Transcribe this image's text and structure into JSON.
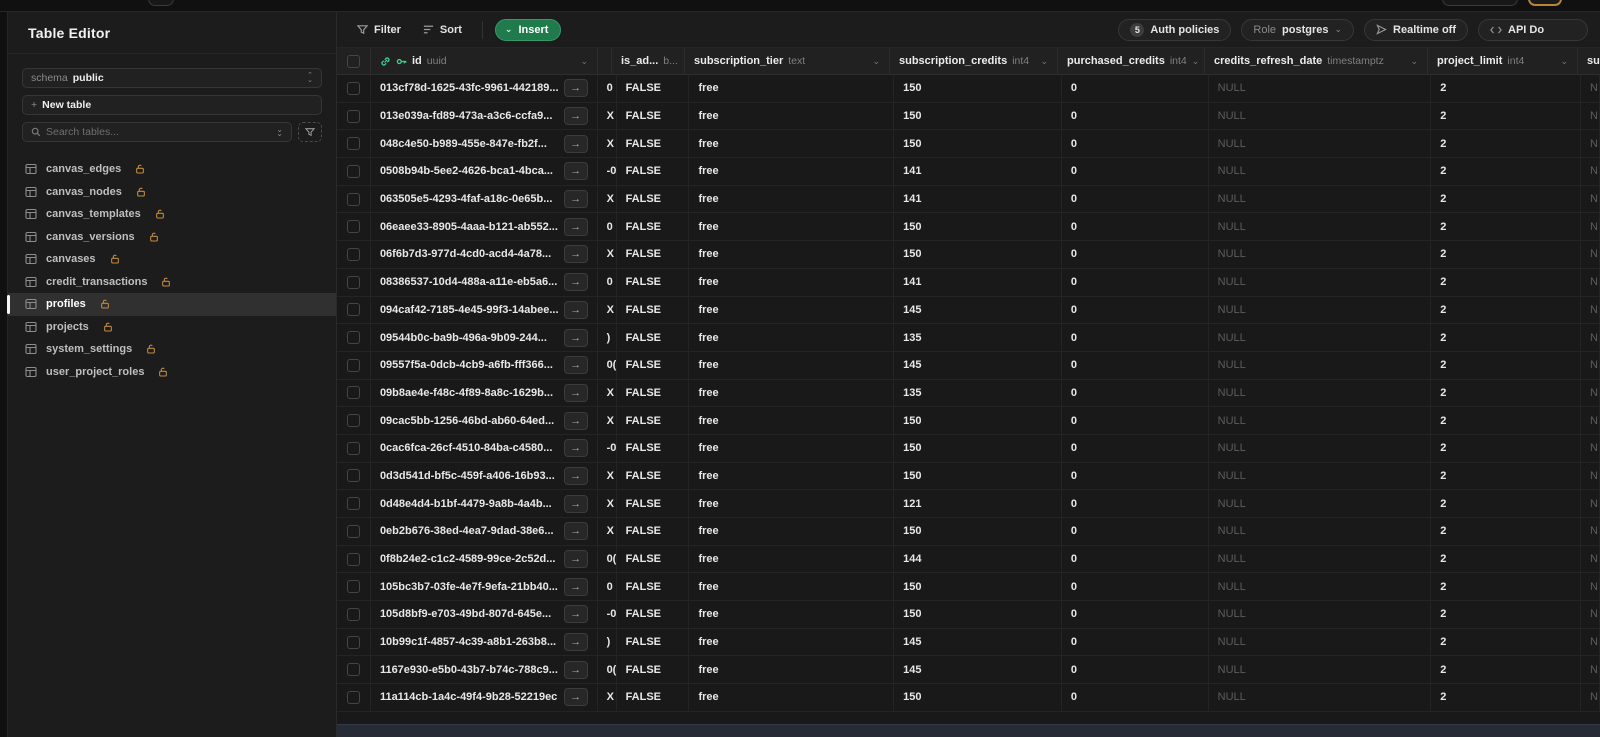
{
  "sidebar": {
    "title": "Table Editor",
    "schema_label": "schema",
    "schema_value": "public",
    "new_table_label": "New table",
    "search_placeholder": "Search tables...",
    "tables": [
      {
        "name": "canvas_edges",
        "selected": false,
        "locked": false
      },
      {
        "name": "canvas_nodes",
        "selected": false,
        "locked": false
      },
      {
        "name": "canvas_templates",
        "selected": false,
        "locked": false
      },
      {
        "name": "canvas_versions",
        "selected": false,
        "locked": false
      },
      {
        "name": "canvases",
        "selected": false,
        "locked": false
      },
      {
        "name": "credit_transactions",
        "selected": false,
        "locked": false
      },
      {
        "name": "profiles",
        "selected": true,
        "locked": false
      },
      {
        "name": "projects",
        "selected": false,
        "locked": false
      },
      {
        "name": "system_settings",
        "selected": false,
        "locked": true
      },
      {
        "name": "user_project_roles",
        "selected": false,
        "locked": false
      }
    ]
  },
  "toolbar": {
    "filter_label": "Filter",
    "sort_label": "Sort",
    "insert_label": "Insert",
    "auth_policies_count": "5",
    "auth_policies_label": "Auth policies",
    "role_label": "Role",
    "role_value": "postgres",
    "realtime_label": "Realtime off",
    "api_docs_label": "API Do"
  },
  "grid": {
    "columns": [
      {
        "name": "id",
        "type": "uuid"
      },
      {
        "name": "is_ad...",
        "type": "b..."
      },
      {
        "name": "subscription_tier",
        "type": "text"
      },
      {
        "name": "subscription_credits",
        "type": "int4"
      },
      {
        "name": "purchased_credits",
        "type": "int4"
      },
      {
        "name": "credits_refresh_date",
        "type": "timestamptz"
      },
      {
        "name": "project_limit",
        "type": "int4"
      },
      {
        "name": "su",
        "type": ""
      }
    ],
    "rows": [
      {
        "id": "013cf78d-1625-43fc-9961-442189...",
        "clip": "0",
        "is_admin": "FALSE",
        "subscription_tier": "free",
        "subscription_credits": "150",
        "purchased_credits": "0",
        "credits_refresh_date": "NULL",
        "project_limit": "2",
        "last": "N"
      },
      {
        "id": "013e039a-fd89-473a-a3c6-ccfa9...",
        "clip": "X",
        "is_admin": "FALSE",
        "subscription_tier": "free",
        "subscription_credits": "150",
        "purchased_credits": "0",
        "credits_refresh_date": "NULL",
        "project_limit": "2",
        "last": "N"
      },
      {
        "id": "048c4e50-b989-455e-847e-fb2f...",
        "clip": "X",
        "is_admin": "FALSE",
        "subscription_tier": "free",
        "subscription_credits": "150",
        "purchased_credits": "0",
        "credits_refresh_date": "NULL",
        "project_limit": "2",
        "last": "N"
      },
      {
        "id": "0508b94b-5ee2-4626-bca1-4bca...",
        "clip": "-0",
        "is_admin": "FALSE",
        "subscription_tier": "free",
        "subscription_credits": "141",
        "purchased_credits": "0",
        "credits_refresh_date": "NULL",
        "project_limit": "2",
        "last": "N"
      },
      {
        "id": "063505e5-4293-4faf-a18c-0e65b...",
        "clip": "X",
        "is_admin": "FALSE",
        "subscription_tier": "free",
        "subscription_credits": "141",
        "purchased_credits": "0",
        "credits_refresh_date": "NULL",
        "project_limit": "2",
        "last": "N"
      },
      {
        "id": "06eaee33-8905-4aaa-b121-ab552...",
        "clip": "0",
        "is_admin": "FALSE",
        "subscription_tier": "free",
        "subscription_credits": "150",
        "purchased_credits": "0",
        "credits_refresh_date": "NULL",
        "project_limit": "2",
        "last": "N"
      },
      {
        "id": "06f6b7d3-977d-4cd0-acd4-4a78...",
        "clip": "X",
        "is_admin": "FALSE",
        "subscription_tier": "free",
        "subscription_credits": "150",
        "purchased_credits": "0",
        "credits_refresh_date": "NULL",
        "project_limit": "2",
        "last": "N"
      },
      {
        "id": "08386537-10d4-488a-a11e-eb5a6...",
        "clip": "0",
        "is_admin": "FALSE",
        "subscription_tier": "free",
        "subscription_credits": "141",
        "purchased_credits": "0",
        "credits_refresh_date": "NULL",
        "project_limit": "2",
        "last": "N"
      },
      {
        "id": "094caf42-7185-4e45-99f3-14abee...",
        "clip": "X",
        "is_admin": "FALSE",
        "subscription_tier": "free",
        "subscription_credits": "145",
        "purchased_credits": "0",
        "credits_refresh_date": "NULL",
        "project_limit": "2",
        "last": "N"
      },
      {
        "id": "09544b0c-ba9b-496a-9b09-244...",
        "clip": ")",
        "is_admin": "FALSE",
        "subscription_tier": "free",
        "subscription_credits": "135",
        "purchased_credits": "0",
        "credits_refresh_date": "NULL",
        "project_limit": "2",
        "last": "N"
      },
      {
        "id": "09557f5a-0dcb-4cb9-a6fb-fff366...",
        "clip": "0(",
        "is_admin": "FALSE",
        "subscription_tier": "free",
        "subscription_credits": "145",
        "purchased_credits": "0",
        "credits_refresh_date": "NULL",
        "project_limit": "2",
        "last": "N"
      },
      {
        "id": "09b8ae4e-f48c-4f89-8a8c-1629b...",
        "clip": "X",
        "is_admin": "FALSE",
        "subscription_tier": "free",
        "subscription_credits": "135",
        "purchased_credits": "0",
        "credits_refresh_date": "NULL",
        "project_limit": "2",
        "last": "N"
      },
      {
        "id": "09cac5bb-1256-46bd-ab60-64ed...",
        "clip": "X",
        "is_admin": "FALSE",
        "subscription_tier": "free",
        "subscription_credits": "150",
        "purchased_credits": "0",
        "credits_refresh_date": "NULL",
        "project_limit": "2",
        "last": "N"
      },
      {
        "id": "0cac6fca-26cf-4510-84ba-c4580...",
        "clip": "-0",
        "is_admin": "FALSE",
        "subscription_tier": "free",
        "subscription_credits": "150",
        "purchased_credits": "0",
        "credits_refresh_date": "NULL",
        "project_limit": "2",
        "last": "N"
      },
      {
        "id": "0d3d541d-bf5c-459f-a406-16b93...",
        "clip": "X",
        "is_admin": "FALSE",
        "subscription_tier": "free",
        "subscription_credits": "150",
        "purchased_credits": "0",
        "credits_refresh_date": "NULL",
        "project_limit": "2",
        "last": "N"
      },
      {
        "id": "0d48e4d4-b1bf-4479-9a8b-4a4b...",
        "clip": "X",
        "is_admin": "FALSE",
        "subscription_tier": "free",
        "subscription_credits": "121",
        "purchased_credits": "0",
        "credits_refresh_date": "NULL",
        "project_limit": "2",
        "last": "N"
      },
      {
        "id": "0eb2b676-38ed-4ea7-9dad-38e6...",
        "clip": "X",
        "is_admin": "FALSE",
        "subscription_tier": "free",
        "subscription_credits": "150",
        "purchased_credits": "0",
        "credits_refresh_date": "NULL",
        "project_limit": "2",
        "last": "N"
      },
      {
        "id": "0f8b24e2-c1c2-4589-99ce-2c52d...",
        "clip": "0(",
        "is_admin": "FALSE",
        "subscription_tier": "free",
        "subscription_credits": "144",
        "purchased_credits": "0",
        "credits_refresh_date": "NULL",
        "project_limit": "2",
        "last": "N"
      },
      {
        "id": "105bc3b7-03fe-4e7f-9efa-21bb40...",
        "clip": "0",
        "is_admin": "FALSE",
        "subscription_tier": "free",
        "subscription_credits": "150",
        "purchased_credits": "0",
        "credits_refresh_date": "NULL",
        "project_limit": "2",
        "last": "N"
      },
      {
        "id": "105d8bf9-e703-49bd-807d-645e...",
        "clip": "-0",
        "is_admin": "FALSE",
        "subscription_tier": "free",
        "subscription_credits": "150",
        "purchased_credits": "0",
        "credits_refresh_date": "NULL",
        "project_limit": "2",
        "last": "N"
      },
      {
        "id": "10b99c1f-4857-4c39-a8b1-263b8...",
        "clip": ")",
        "is_admin": "FALSE",
        "subscription_tier": "free",
        "subscription_credits": "145",
        "purchased_credits": "0",
        "credits_refresh_date": "NULL",
        "project_limit": "2",
        "last": "N"
      },
      {
        "id": "1167e930-e5b0-43b7-b74c-788c9...",
        "clip": "0(",
        "is_admin": "FALSE",
        "subscription_tier": "free",
        "subscription_credits": "145",
        "purchased_credits": "0",
        "credits_refresh_date": "NULL",
        "project_limit": "2",
        "last": "N"
      },
      {
        "id": "11a114cb-1a4c-49f4-9b28-52219ec...",
        "clip": "X",
        "is_admin": "FALSE",
        "subscription_tier": "free",
        "subscription_credits": "150",
        "purchased_credits": "0",
        "credits_refresh_date": "NULL",
        "project_limit": "2",
        "last": "N"
      }
    ]
  },
  "colors": {
    "accent_green": "#3ecf8e",
    "insert_button_green": "#1f7a4c",
    "lock_amber": "#c08a3e",
    "null_grey": "#5c5c5c"
  }
}
